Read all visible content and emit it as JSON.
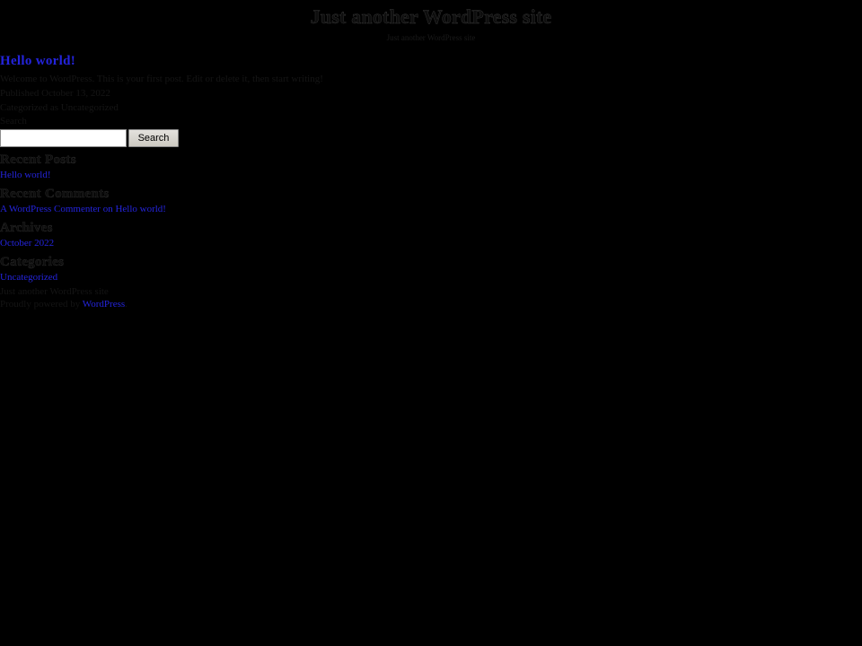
{
  "header": {
    "site_title": "Just another WordPress site",
    "site_description": "Just another WordPress site"
  },
  "post": {
    "title": "Hello world!",
    "content": "Welcome to WordPress. This is your first post. Edit or delete it, then start writing!",
    "published_line": "Published October 13, 2022",
    "category_line": "Categorized as Uncategorized"
  },
  "search": {
    "label": "Search",
    "value": "",
    "placeholder": "",
    "button_label": "Search"
  },
  "widgets": {
    "recent_posts": {
      "title": "Recent Posts",
      "items": [
        {
          "label": "Hello world!"
        }
      ]
    },
    "recent_comments": {
      "title": "Recent Comments",
      "items": [
        {
          "label": "A WordPress Commenter on Hello world!"
        }
      ]
    },
    "archives": {
      "title": "Archives",
      "items": [
        {
          "label": "October 2022"
        }
      ]
    },
    "categories": {
      "title": "Categories",
      "items": [
        {
          "label": "Uncategorized"
        }
      ]
    }
  },
  "footer": {
    "tagline": "Just another WordPress site",
    "credit_prefix": "Proudly powered by ",
    "credit_link": "WordPress",
    "credit_suffix": "."
  },
  "colors": {
    "background": "#000000",
    "link": "#2424dd",
    "text": "#141414",
    "heading": "#0d0d0d",
    "button_face": "#d4d0c8",
    "input_background": "#ffffff"
  }
}
